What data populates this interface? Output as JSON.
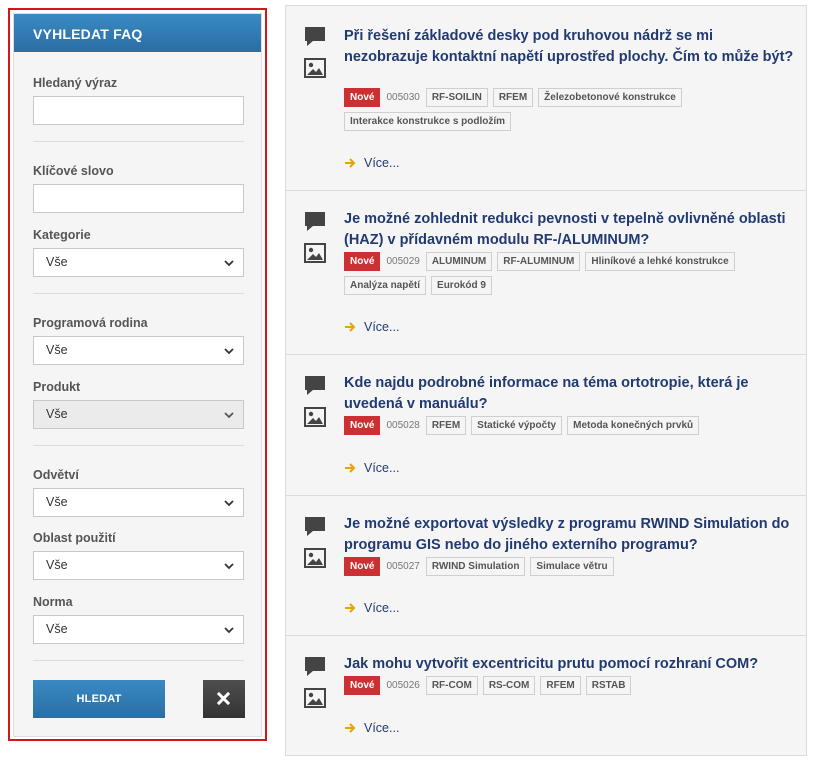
{
  "sidebar": {
    "title": "VYHLEDAT FAQ",
    "search_term_label": "Hledaný výraz",
    "search_term_value": "",
    "keyword_label": "Klíčové slovo",
    "keyword_value": "",
    "category_label": "Kategorie",
    "category_value": "Vše",
    "program_family_label": "Programová rodina",
    "program_family_value": "Vše",
    "product_label": "Produkt",
    "product_value": "Vše",
    "industry_label": "Odvětví",
    "industry_value": "Vše",
    "application_area_label": "Oblast použití",
    "application_area_value": "Vše",
    "standard_label": "Norma",
    "standard_value": "Vše",
    "search_button": "HLEDAT",
    "reset_icon": "close-icon"
  },
  "faq": {
    "new_badge": "Nové",
    "more_label": "Více...",
    "items": [
      {
        "title": "Při řešení základové desky pod kruhovou nádrž se mi nezobrazuje kontaktní napětí uprostřed plochy. Čím to může být?",
        "id": "005030",
        "tags": [
          "RF-SOILIN",
          "RFEM",
          "Železobetonové konstrukce",
          "Interakce konstrukce s podložím"
        ]
      },
      {
        "title": "Je možné zohlednit redukci pevnosti v tepelně ovlivněné oblasti (HAZ) v přídavném modulu RF-/ALUMINUM?",
        "id": "005029",
        "tags": [
          "ALUMINUM",
          "RF-ALUMINUM",
          "Hliníkové a lehké konstrukce",
          "Analýza napětí",
          "Eurokód 9"
        ]
      },
      {
        "title": "Kde najdu podrobné informace na téma ortotropie, která je uvedená v manuálu?",
        "id": "005028",
        "tags": [
          "RFEM",
          "Statické výpočty",
          "Metoda konečných prvků"
        ]
      },
      {
        "title": "Je možné exportovat výsledky z programu RWIND Simulation do programu GIS nebo do jiného externího programu?",
        "id": "005027",
        "tags": [
          "RWIND Simulation",
          "Simulace větru"
        ]
      },
      {
        "title": "Jak mohu vytvořit excentricitu prutu pomocí rozhraní COM?",
        "id": "005026",
        "tags": [
          "RF-COM",
          "RS-COM",
          "RFEM",
          "RSTAB"
        ]
      }
    ]
  },
  "colors": {
    "accent_blue": "#2a6ea5",
    "title_navy": "#213a71",
    "badge_red": "#cc3033",
    "arrow_orange": "#e8a400",
    "highlight_border": "#d4151c"
  }
}
